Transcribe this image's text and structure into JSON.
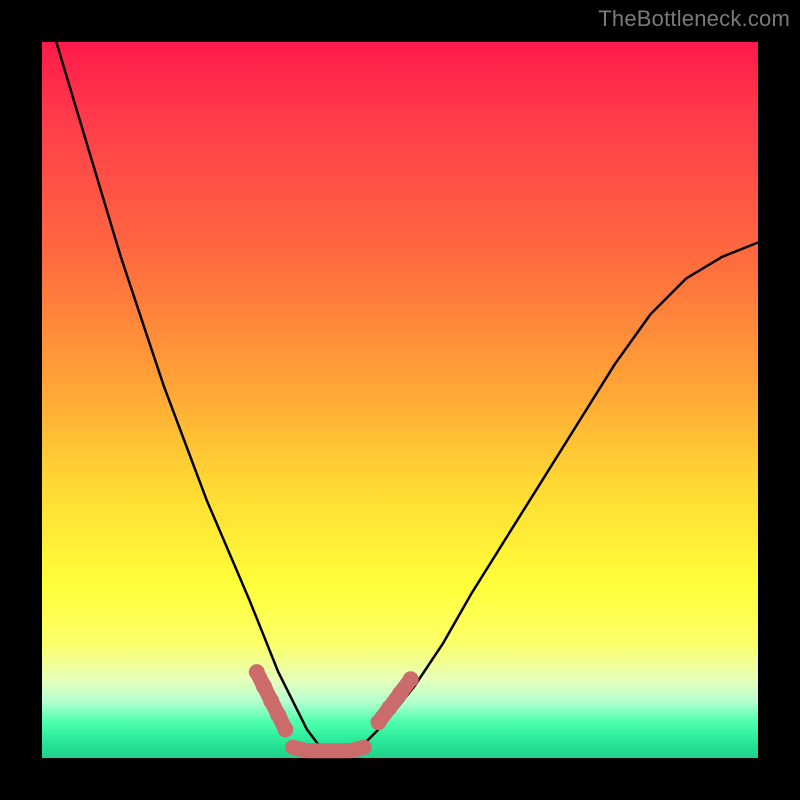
{
  "watermark": "TheBottleneck.com",
  "chart_data": {
    "type": "line",
    "title": "",
    "xlabel": "",
    "ylabel": "",
    "xlim": [
      0,
      100
    ],
    "ylim": [
      0,
      100
    ],
    "series": [
      {
        "name": "bottleneck-curve",
        "x": [
          2,
          5,
          8,
          11,
          14,
          17,
          20,
          23,
          26,
          29,
          31,
          33,
          35,
          37,
          38.5,
          40,
          42,
          45,
          48,
          52,
          56,
          60,
          65,
          70,
          75,
          80,
          85,
          90,
          95,
          100
        ],
        "values": [
          100,
          90,
          80,
          70,
          61,
          52,
          44,
          36,
          29,
          22,
          17,
          12,
          8,
          4,
          2,
          1,
          1,
          2,
          5,
          10,
          16,
          23,
          31,
          39,
          47,
          55,
          62,
          67,
          70,
          72
        ]
      }
    ],
    "markers": [
      {
        "name": "left-cluster",
        "x": [
          30,
          31,
          32,
          33,
          34
        ],
        "y": [
          12,
          10,
          8,
          6,
          4
        ]
      },
      {
        "name": "floor",
        "x": [
          35,
          37,
          39,
          41,
          43,
          45
        ],
        "y": [
          1.5,
          1,
          1,
          1,
          1,
          1.5
        ]
      },
      {
        "name": "right-cluster",
        "x": [
          47,
          48.5,
          50,
          51.5
        ],
        "y": [
          5,
          7,
          9,
          11
        ]
      }
    ],
    "colors": {
      "curve": "#000000",
      "marker": "#cc6b6b"
    }
  }
}
